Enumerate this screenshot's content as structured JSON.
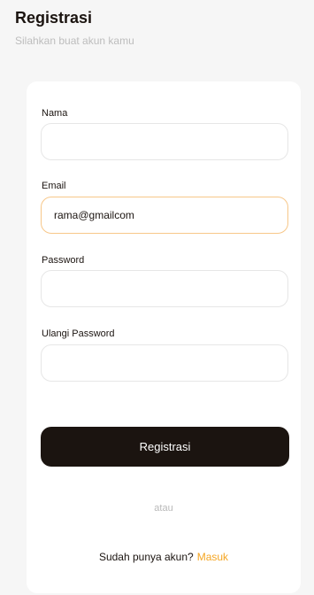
{
  "header": {
    "title": "Registrasi",
    "subtitle": "Silahkan buat akun kamu"
  },
  "form": {
    "name_label": "Nama",
    "name_value": "",
    "email_label": "Email",
    "email_value": "rama@gmailcom",
    "password_label": "Password",
    "password_value": "",
    "confirm_label": "Ulangi Password",
    "confirm_value": "",
    "submit_label": "Registrasi"
  },
  "divider_text": "atau",
  "footer": {
    "prompt": "Sudah punya akun?",
    "link_label": "Masuk"
  },
  "colors": {
    "primary": "#1b1410",
    "accent": "#f5a623",
    "focus_border": "#f7c789",
    "background": "#f6f6f6"
  }
}
